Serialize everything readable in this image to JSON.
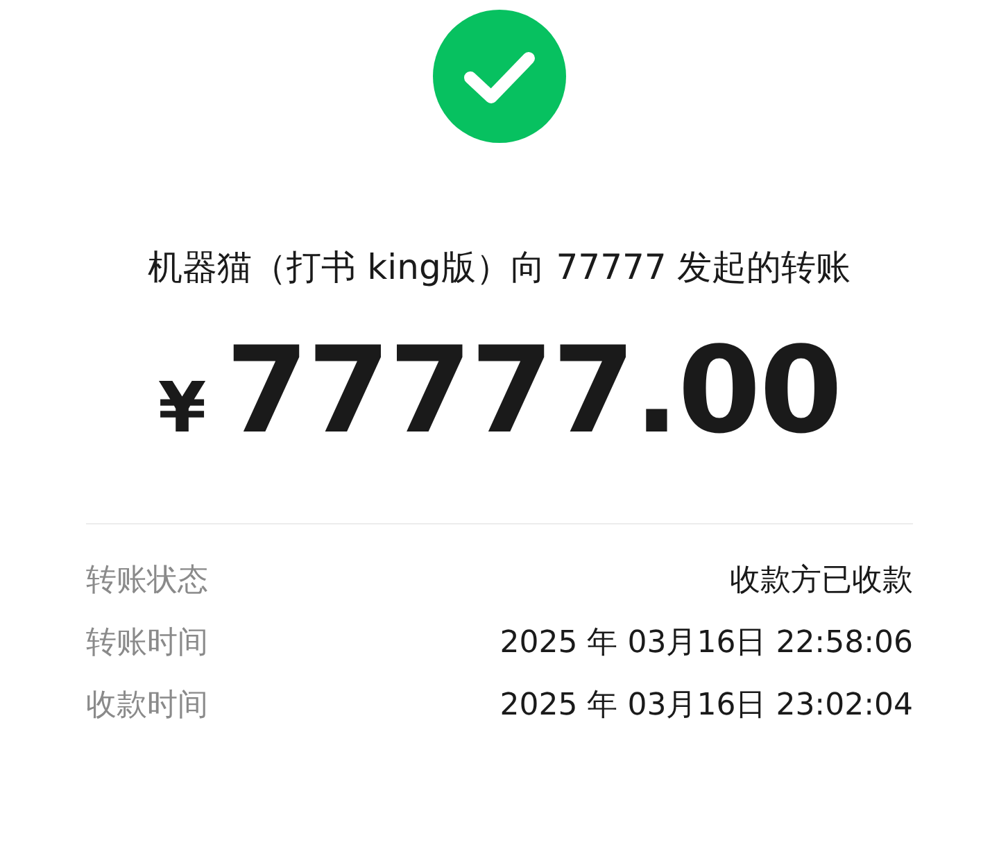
{
  "status": {
    "kind": "success"
  },
  "title": "机器猫（打书 king版）向 77777 发起的转账",
  "amount": {
    "currency": "¥",
    "value": "77777.00"
  },
  "details": [
    {
      "label": "转账状态",
      "value": "收款方已收款"
    },
    {
      "label": "转账时间",
      "value": "2025 年 03月16日 22:58:06"
    },
    {
      "label": "收款时间",
      "value": "2025 年 03月16日 23:02:04"
    }
  ]
}
